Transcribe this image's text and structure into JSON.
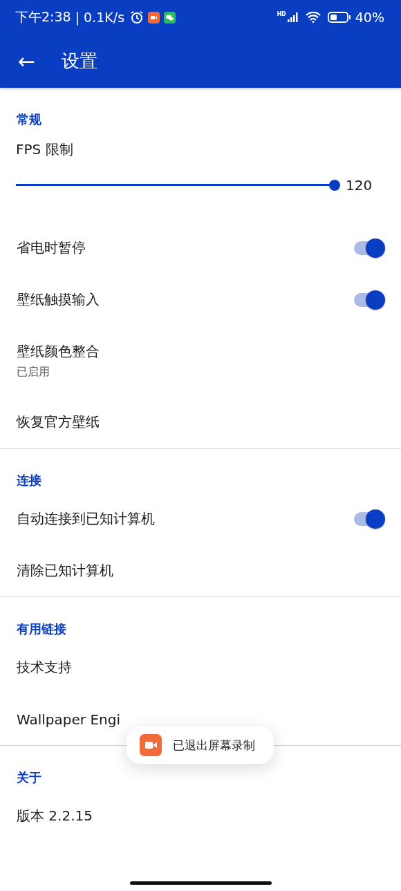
{
  "status_bar": {
    "time": "下午2:38",
    "speed": "| 0.1K/s",
    "network": "HD",
    "battery_text": "40%"
  },
  "toolbar": {
    "back": "←",
    "title": "设置"
  },
  "sections": [
    {
      "title": "常规",
      "items": [
        {
          "kind": "slider",
          "label": "FPS 限制",
          "level": 1,
          "reading": "120"
        },
        {
          "kind": "switch",
          "label": "省电时暂停",
          "on": true
        },
        {
          "kind": "switch",
          "label": "壁纸触摸输入",
          "on": true
        },
        {
          "kind": "text",
          "label": "壁纸颜色整合",
          "summary": "已启用"
        },
        {
          "kind": "text",
          "label": "恢复官方壁纸"
        }
      ]
    },
    {
      "title": "连接",
      "items": [
        {
          "kind": "switch",
          "label": "自动连接到已知计算机",
          "on": true
        },
        {
          "kind": "text",
          "label": "清除已知计算机"
        }
      ]
    },
    {
      "title": "有用链接",
      "items": [
        {
          "kind": "text",
          "label": "技术支持"
        },
        {
          "kind": "text",
          "label": "Wallpaper Engi"
        }
      ]
    },
    {
      "title": "关于",
      "items": [
        {
          "kind": "text",
          "label": "版本 2.2.15"
        }
      ]
    }
  ],
  "toast": {
    "text": "已退出屏幕录制"
  }
}
